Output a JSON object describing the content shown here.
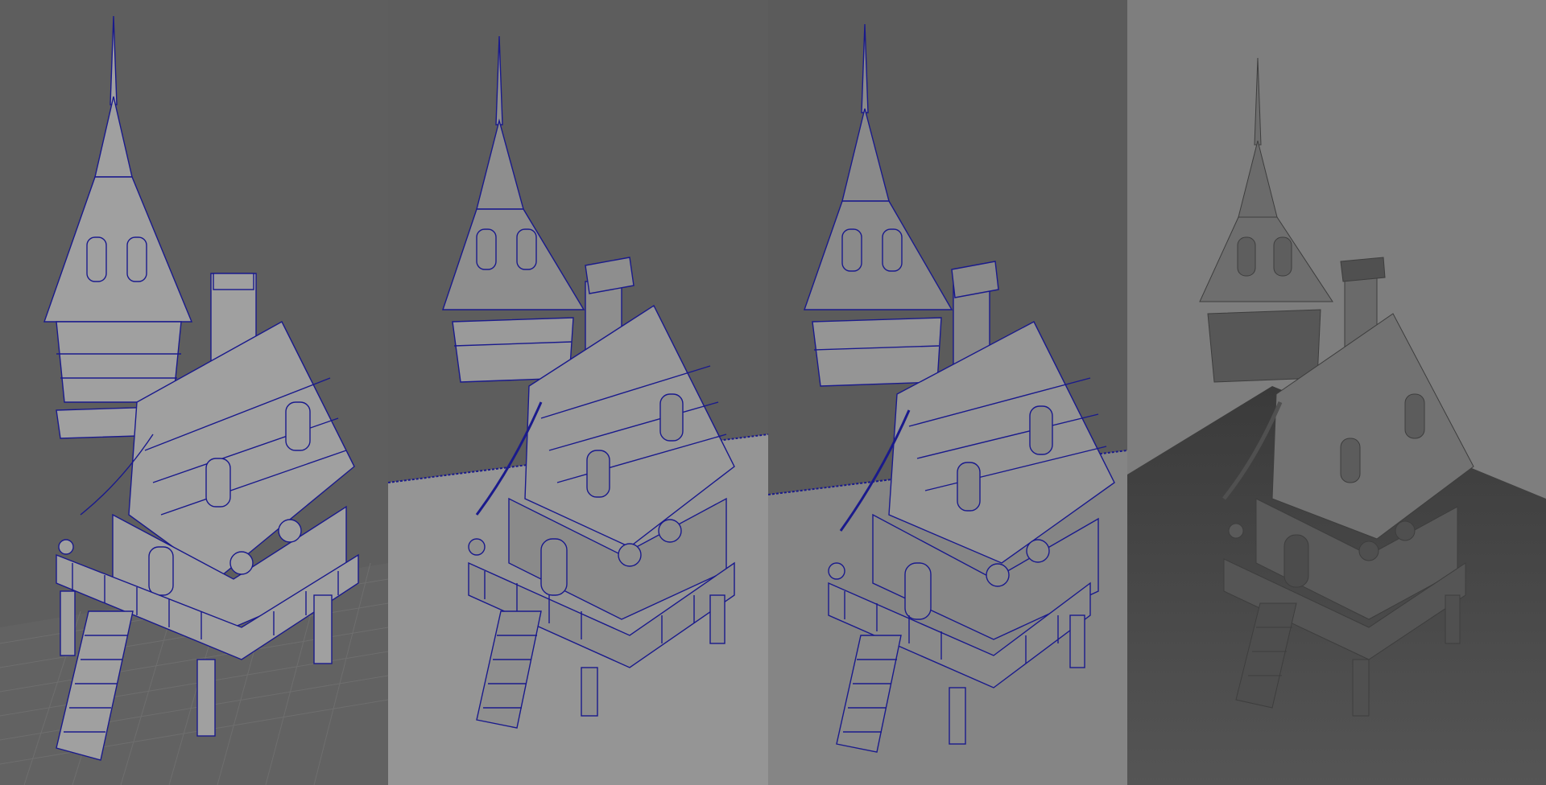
{
  "viewports": [
    {
      "id": "wireframe-grid",
      "mode": "wireframe-on-shaded",
      "floor": "grid"
    },
    {
      "id": "wireframe-floor-light",
      "mode": "wireframe-on-shaded",
      "floor": "plane"
    },
    {
      "id": "wireframe-floor-mid",
      "mode": "wireframe-on-shaded",
      "floor": "plane"
    },
    {
      "id": "smooth-shaded",
      "mode": "smooth-shaded",
      "floor": "plane"
    }
  ],
  "colors": {
    "wire": "#1a1a8c",
    "model_fill": "#9a9a9a",
    "model_fill_dark": "#7d7d7d",
    "shaded_fill": "#6a6a6a",
    "shaded_dark": "#4a4a4a"
  }
}
